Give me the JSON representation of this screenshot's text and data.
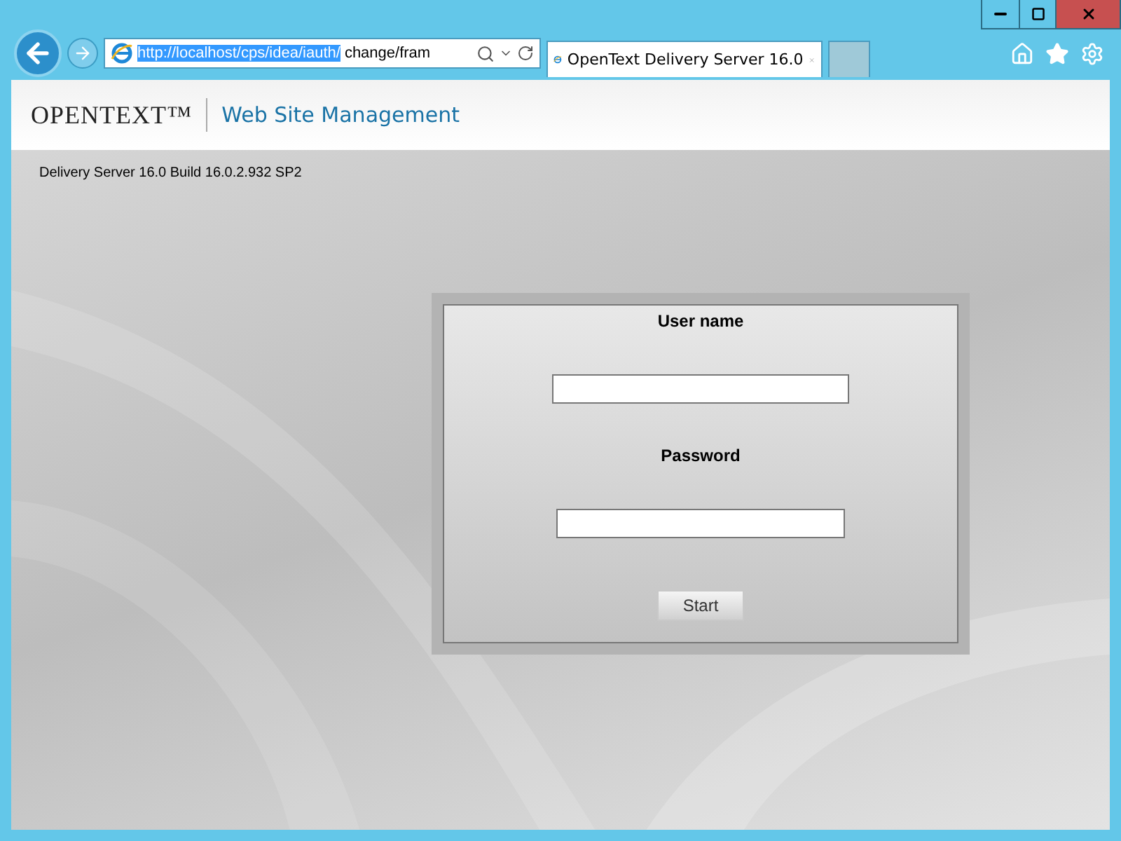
{
  "browser": {
    "address": {
      "selected_text": "http://localhost/cps/idea/iauth/",
      "rest_text": "change/fram"
    },
    "tabs": [
      {
        "title": "OpenText Delivery Server 16.0",
        "selected": true
      },
      {
        "selected": false
      }
    ]
  },
  "header": {
    "logo": "OPENTEXT™",
    "title": "Web Site Management"
  },
  "version": "Delivery Server 16.0 Build 16.0.2.932 SP2",
  "login": {
    "fields": [
      {
        "label": "User name",
        "kind": "text"
      },
      {
        "label": "Password",
        "kind": "password"
      }
    ],
    "button": "Start"
  }
}
